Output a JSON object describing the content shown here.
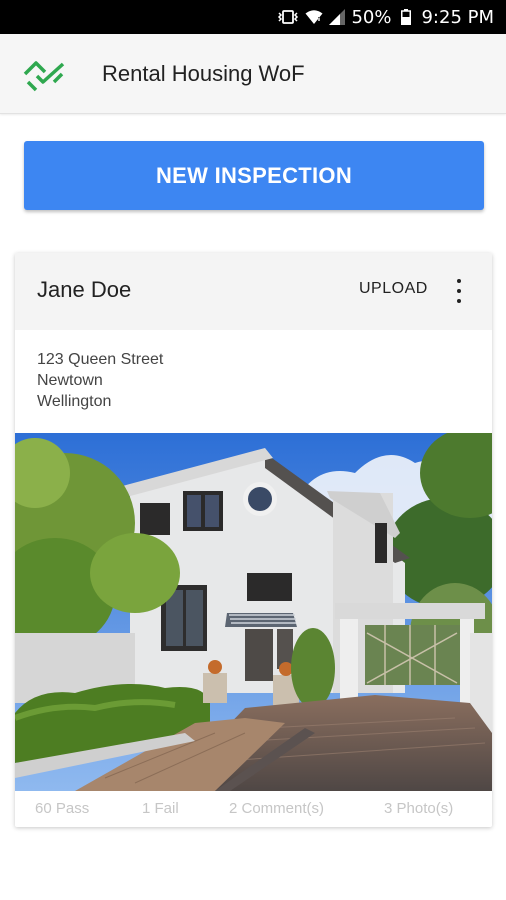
{
  "status_bar": {
    "battery": "50%",
    "time": "9:25 PM",
    "icons": [
      "vibrate-icon",
      "wifi-icon",
      "signal-icon",
      "battery-icon"
    ]
  },
  "app_bar": {
    "title": "Rental Housing WoF",
    "logo": "wof-logo-icon",
    "accent": "#2fa84f"
  },
  "primary_action": {
    "label": "NEW INSPECTION",
    "color": "#3d86f2"
  },
  "inspection_card": {
    "name": "Jane Doe",
    "upload_label": "UPLOAD",
    "menu_icon": "more-vert-icon",
    "address": {
      "line1": "123 Queen Street",
      "line2": "Newtown",
      "line3": "Wellington"
    },
    "photo": "house-photo",
    "stats": {
      "pass": "60 Pass",
      "fail": "1 Fail",
      "comments": "2 Comment(s)",
      "photos": "3 Photo(s)"
    }
  }
}
